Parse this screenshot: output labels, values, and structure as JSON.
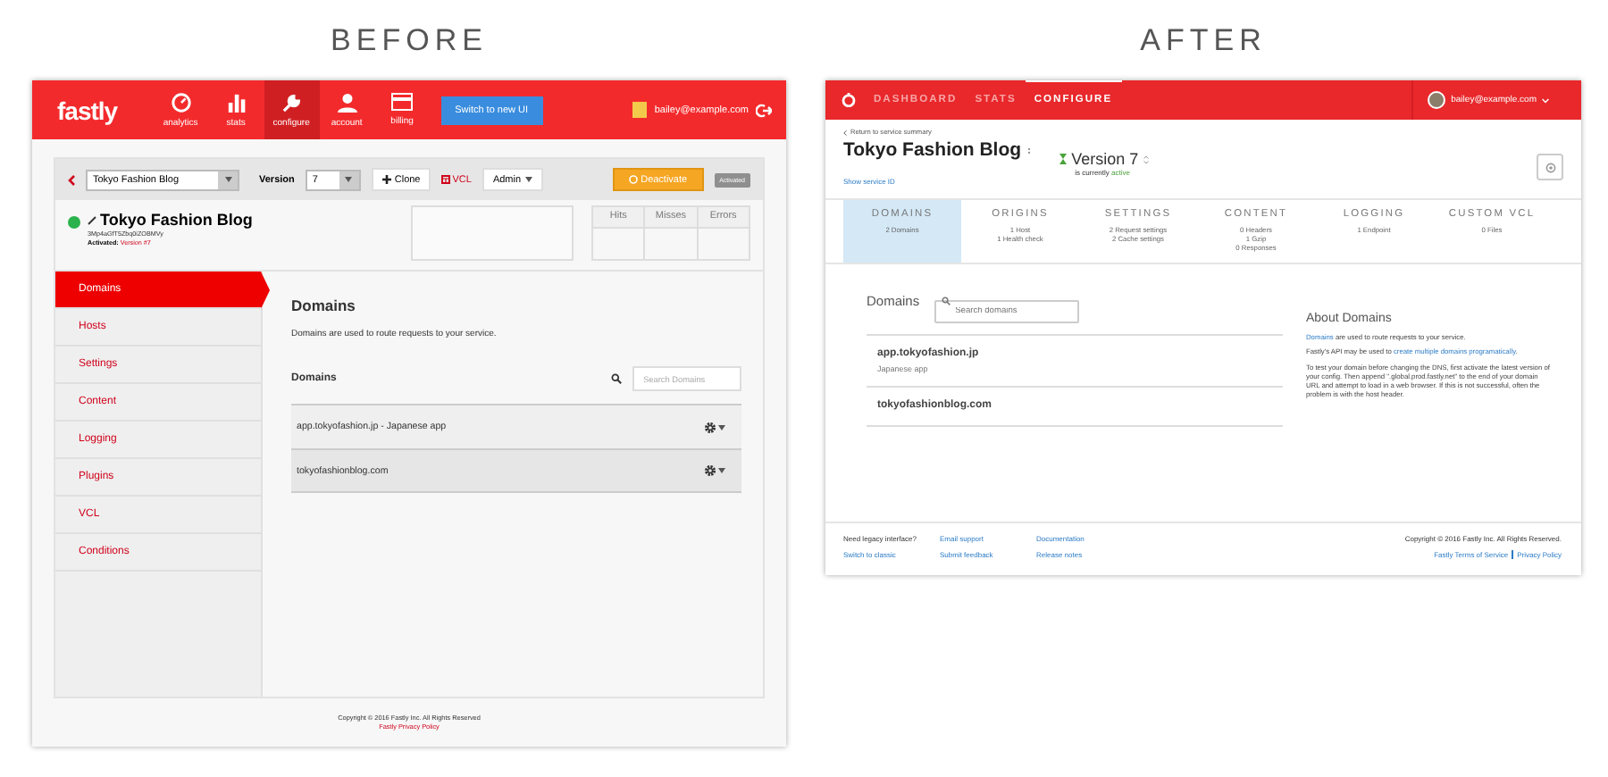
{
  "before": {
    "heading": "BEFORE",
    "nav": {
      "logo": "fastly",
      "items": [
        {
          "label": "analytics",
          "kind": "gauge",
          "selected": false
        },
        {
          "label": "stats",
          "kind": "bars",
          "selected": false
        },
        {
          "label": "configure",
          "kind": "wrench",
          "selected": true
        },
        {
          "label": "account",
          "kind": "person",
          "selected": false
        },
        {
          "label": "billing",
          "kind": "card",
          "selected": false
        }
      ],
      "switch_button": "Switch to new UI",
      "user": "bailey@example.com"
    },
    "toolbar": {
      "service_select": "Tokyo Fashion Blog",
      "version_label": "Version",
      "version_select": "7",
      "clone_button": "Clone",
      "vcl_button": "VCL",
      "admin_button": "Admin",
      "deactivate_button": "Deactivate",
      "status_badge": "Activated"
    },
    "service": {
      "name": "Tokyo Fashion Blog",
      "id": "3Mp4aGfT5Zbq0iZOBMVy",
      "active": true,
      "activated_label": "Activated:",
      "activated_version": "Version #7",
      "stats_columns": [
        "Hits",
        "Misses",
        "Errors"
      ]
    },
    "sidebar": [
      {
        "label": "Domains",
        "selected": true
      },
      {
        "label": "Hosts",
        "selected": false
      },
      {
        "label": "Settings",
        "selected": false
      },
      {
        "label": "Content",
        "selected": false
      },
      {
        "label": "Logging",
        "selected": false
      },
      {
        "label": "Plugins",
        "selected": false
      },
      {
        "label": "VCL",
        "selected": false
      },
      {
        "label": "Conditions",
        "selected": false
      }
    ],
    "content": {
      "title": "Domains",
      "description": "Domains are used to route requests to your service.",
      "list_title": "Domains",
      "search": {
        "placeholder": "Search Domains"
      },
      "rows": [
        "app.tokyofashion.jp - Japanese app",
        "tokyofashionblog.com"
      ]
    },
    "footer": {
      "copyright": "Copyright © 2016 Fastly Inc. All Rights Reserved",
      "link": "Fastly Privacy Policy"
    }
  },
  "after": {
    "heading": "AFTER",
    "nav": {
      "items": [
        {
          "label": "DASHBOARD",
          "selected": false
        },
        {
          "label": "STATS",
          "selected": false
        },
        {
          "label": "CONFIGURE",
          "selected": true
        }
      ],
      "user": "bailey@example.com"
    },
    "header": {
      "back_link": "Return to service summary",
      "title": "Tokyo Fashion Blog",
      "show_id_link": "Show service ID",
      "version": "Version 7",
      "status_prefix": "is currently",
      "status": "active"
    },
    "tabs": [
      {
        "label": "DOMAINS",
        "details": [
          "2 Domains"
        ],
        "selected": true
      },
      {
        "label": "ORIGINS",
        "details": [
          "1 Host",
          "1 Health check"
        ],
        "selected": false
      },
      {
        "label": "SETTINGS",
        "details": [
          "2 Request settings",
          "2 Cache settings"
        ],
        "selected": false
      },
      {
        "label": "CONTENT",
        "details": [
          "0 Headers",
          "1 Gzip",
          "0 Responses"
        ],
        "selected": false
      },
      {
        "label": "LOGGING",
        "details": [
          "1 Endpoint"
        ],
        "selected": false
      },
      {
        "label": "CUSTOM VCL",
        "details": [
          "0 Files"
        ],
        "selected": false
      }
    ],
    "domains": {
      "title": "Domains",
      "search": {
        "placeholder": "Search domains"
      },
      "rows": [
        {
          "name": "app.tokyofashion.jp",
          "description": "Japanese app"
        },
        {
          "name": "tokyofashionblog.com"
        }
      ]
    },
    "about": {
      "title": "About Domains",
      "paragraphs": [
        [
          {
            "text": "Domains",
            "kind": "link"
          },
          {
            "text": " are used to route requests to your service.",
            "kind": "text"
          }
        ],
        [
          {
            "text": "Fastly's API may be used to ",
            "kind": "text"
          },
          {
            "text": "create multiple domains programatically",
            "kind": "link"
          },
          {
            "text": ".",
            "kind": "text"
          }
        ],
        [
          {
            "text": "To test your domain before changing the DNS, first activate the latest version of your config. Then append \".global.prod.fastly.net\" to the end of your domain URL and attempt to load in a web browser. If this is not successful, often the problem is with the host header.",
            "kind": "text"
          }
        ]
      ]
    },
    "footer": {
      "columns": [
        [
          {
            "text": "Need legacy interface?",
            "kind": "text"
          },
          {
            "text": "Switch to classic",
            "kind": "link"
          }
        ],
        [
          {
            "text": "Email support",
            "kind": "link"
          },
          {
            "text": "Submit feedback",
            "kind": "link"
          }
        ],
        [
          {
            "text": "Documentation",
            "kind": "link"
          },
          {
            "text": "Release notes",
            "kind": "link"
          }
        ]
      ],
      "copyright": "Copyright © 2016 Fastly Inc. All Rights Reserved.",
      "links": [
        "Fastly Terms of Service",
        "Privacy Policy"
      ]
    }
  }
}
